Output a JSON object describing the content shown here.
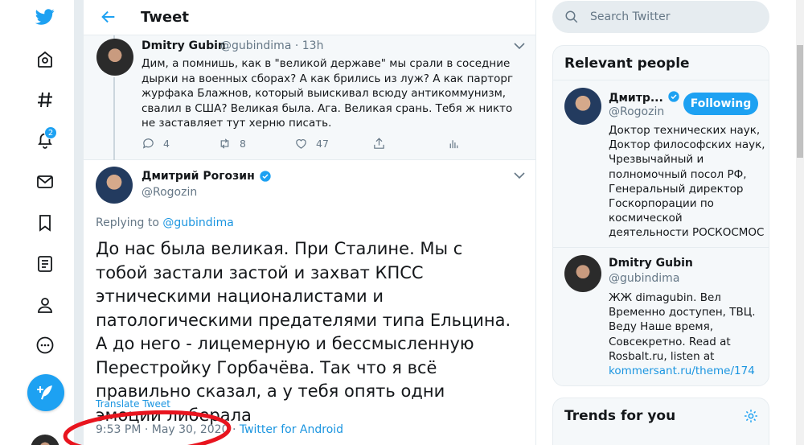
{
  "nav": {
    "notifications_badge": "2",
    "accent": "#1da1f2"
  },
  "header": {
    "title": "Tweet"
  },
  "reply_tweet": {
    "name": "Dmitry Gubin",
    "handle_time": "@gubindima · 13h",
    "text": "Дим, а помнишь, как в \"великой державе\" мы срали в соседние дырки на военных сборах? А как брились из луж? А как парторг журфака Блажнов, который выискивал всюду антикоммунизм, свалил в США? Великая была. Ага. Великая срань. Тебя ж никто не заставляет тут херню писать.",
    "replies": "4",
    "retweets": "8",
    "likes": "47"
  },
  "main_tweet": {
    "name": "Дмитрий Рогозин",
    "handle": "@Rogozin",
    "replying_prefix": "Replying to",
    "replying_to": "@gubindima",
    "text": "До нас была великая. При Сталине. Мы с тобой застали застой и захват КПСС этническими националистами и патологическими предателями типа Ельцина. А до него - лицемерную и бессмысленную Перестройку Горбачёва. Так что я всё правильно сказал, а у тебя опять одни эмоции либерала",
    "translate": "Translate Tweet",
    "timestamp": "9:53 PM · May 30, 2020 · ",
    "source": "Twitter for Android"
  },
  "search": {
    "placeholder": "Search Twitter"
  },
  "relevant_people": {
    "title": "Relevant people",
    "people": [
      {
        "name": "Дмитр...",
        "handle": "@Rogozin",
        "button": "Following",
        "bio": "Доктор технических наук, Доктор философских наук, Чрезвычайный и полномочный посол РФ, Генеральный директор Госкорпорации по космической деятельности РОСКОСМОС"
      },
      {
        "name": "Dmitry Gubin",
        "handle": "@gubindima",
        "bio": "ЖЖ dimagubin. Вел Временно доступен, ТВЦ. Веду Наше время, Совсекретно. Read at Rosbalt.ru, listen at",
        "bio_link": "kommersant.ru/theme/174"
      }
    ]
  },
  "trends": {
    "title": "Trends for you"
  }
}
